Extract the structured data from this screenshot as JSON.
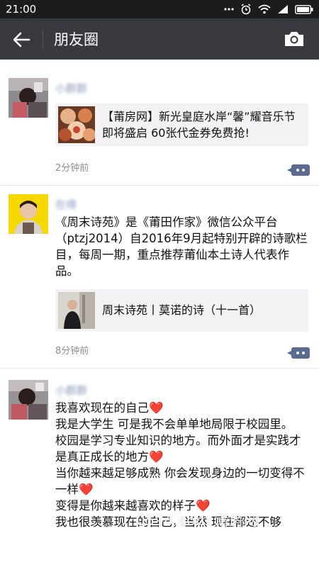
{
  "status_bar": {
    "time": "21:00"
  },
  "header": {
    "title": "朋友圈"
  },
  "posts": [
    {
      "nickname": "小群群",
      "card_title": "【莆房网】新光皇庭水岸“馨”耀音乐节即将盛启 60张代金券免费抢!",
      "time": "2分钟前"
    },
    {
      "nickname": "在得",
      "text": "《周末诗苑》是《莆田作家》微信公众平台（ptzj2014）自2016年9月起特别开辟的诗歌栏目，每周一期，重点推荐莆仙本土诗人代表作品。",
      "card_title": "周末诗苑丨莫诺的诗（十一首）",
      "time": "8分钟前"
    },
    {
      "nickname": "小群群",
      "lines": [
        "我喜欢现在的自己❤️",
        "我是大学生 可是我不会单单地局限于校园里。",
        "校园是学习专业知识的地方。而外面才是实践才是真正成长的地方❤️",
        "当你越来越足够成熟 你会发现身边的一切变得不一样❤️",
        "变得是你越来越喜欢的样子❤️",
        "我也很羡慕现在的自己，当然 现在都还不够"
      ]
    }
  ],
  "watermark": "0594.com 莆房网"
}
